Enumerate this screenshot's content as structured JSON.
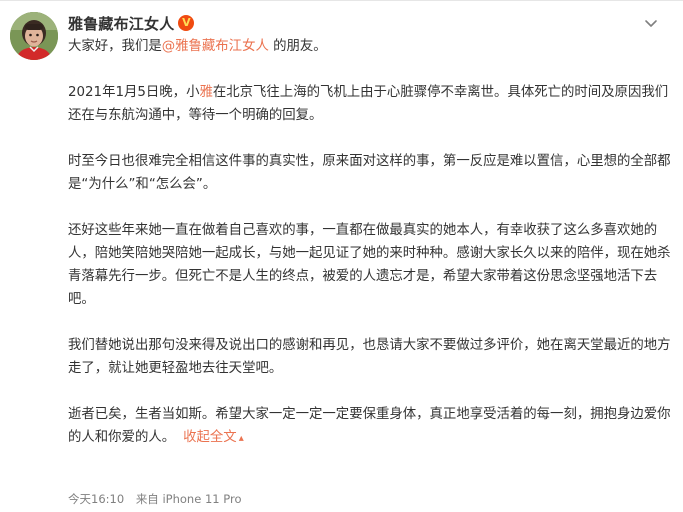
{
  "colors": {
    "accent": "#eb7350",
    "text": "#333333",
    "meta": "#808080",
    "vip_badge": "#f04b10"
  },
  "author": {
    "name": "雅鲁藏布江女人",
    "vip_badge_icon": "verified-v-icon",
    "vip_badge_text": "V"
  },
  "post": {
    "p1": {
      "before": "大家好，我们是",
      "mention": "@雅鲁藏布江女人",
      "after": " 的朋友。"
    },
    "p2": {
      "before": "2021年1月5日晚，小",
      "name": "雅",
      "after": "在北京飞往上海的飞机上由于心脏骤停不幸离世。具体死亡的时间及原因我们还在与东航沟通中，等待一个明确的回复。"
    },
    "p3": "时至今日也很难完全相信这件事的真实性，原来面对这样的事，第一反应是难以置信，心里想的全部都是“为什么”和“怎么会”。",
    "p4": "还好这些年来她一直在做着自己喜欢的事，一直都在做最真实的她本人，有幸收获了这么多喜欢她的人，陪她笑陪她哭陪她一起成长，与她一起见证了她的来时种种。感谢大家长久以来的陪伴，现在她杀青落幕先行一步。但死亡不是人生的终点，被爱的人遗忘才是，希望大家带着这份思念坚强地活下去吧。",
    "p5": "我们替她说出那句没来得及说出口的感谢和再见，也恳请大家不要做过多评价，她在离天堂最近的地方走了，就让她更轻盈地去往天堂吧。",
    "p6": "逝者已矣，生者当如斯。希望大家一定一定一定要保重身体，真正地享受活着的每一刻，拥抱身边爱你的人和你爱的人。",
    "collapse_label": "收起全文",
    "collapse_icon": "caret-up-icon",
    "collapse_caret": "▴"
  },
  "meta": {
    "time": "今天16:10",
    "source": "来自 iPhone 11 Pro"
  },
  "controls": {
    "more_icon": "chevron-down-icon"
  }
}
